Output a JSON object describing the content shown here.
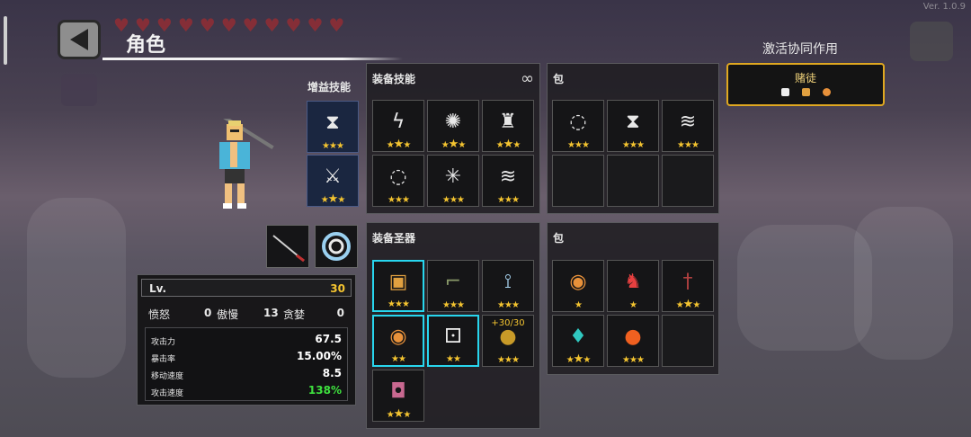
{
  "version": "Ver. 1.0.9",
  "header": {
    "title": "角色",
    "hearts": 11
  },
  "buff_skills": {
    "label": "增益技能",
    "slots": [
      {
        "icon": "hourglass-up-icon",
        "glyph": "⧗",
        "stars": 3,
        "gold": 0
      },
      {
        "icon": "sword-up-icon",
        "glyph": "⚔",
        "stars": 3,
        "gold": 1
      }
    ]
  },
  "equipped_skills": {
    "title": "装备技能",
    "slots": [
      {
        "icon": "lightning-strike-icon",
        "glyph": "ϟ",
        "stars": 3,
        "gold": 1
      },
      {
        "icon": "explosion-icon",
        "glyph": "✺",
        "stars": 3,
        "gold": 1
      },
      {
        "icon": "stone-pillar-icon",
        "glyph": "♜",
        "stars": 3,
        "gold": 1
      },
      {
        "icon": "electric-orb-icon",
        "glyph": "◌",
        "stars": 3,
        "gold": 0
      },
      {
        "icon": "burst-rays-icon",
        "glyph": "✳",
        "stars": 3,
        "gold": 0
      },
      {
        "icon": "cloud-plates-icon",
        "glyph": "≋",
        "stars": 3,
        "gold": 0
      }
    ]
  },
  "skill_bag": {
    "title": "包",
    "slots": [
      {
        "icon": "electric-orb-icon",
        "glyph": "◌",
        "stars": 3,
        "gold": 0
      },
      {
        "icon": "hourglass-up-icon",
        "glyph": "⧗",
        "stars": 3,
        "gold": 0
      },
      {
        "icon": "cloud-plates-icon",
        "glyph": "≋",
        "stars": 3,
        "gold": 0
      },
      null,
      null,
      null
    ]
  },
  "equipped_relics": {
    "title": "装备圣器",
    "slots": [
      {
        "icon": "treasure-box-icon",
        "glyph": "▣",
        "stars": 3,
        "gold": 0,
        "highlight": true,
        "color": "#e0a040"
      },
      {
        "icon": "rifle-icon",
        "glyph": "⌐",
        "stars": 3,
        "gold": 0,
        "color": "#8a9a6a"
      },
      {
        "icon": "ice-branch-icon",
        "glyph": "⟟",
        "stars": 3,
        "gold": 0,
        "color": "#a8d4f0"
      },
      {
        "icon": "orange-shield-icon",
        "glyph": "◉",
        "stars": 2,
        "gold": 0,
        "highlight": true,
        "color": "#e8913a"
      },
      {
        "icon": "dice-icon",
        "glyph": "⚀",
        "stars": 2,
        "gold": 0,
        "highlight": true,
        "color": "#eeeeee"
      },
      {
        "icon": "gold-coin-icon",
        "glyph": "●",
        "stars": 3,
        "gold": 0,
        "counter": "+30/30",
        "color": "#c89a28"
      },
      {
        "icon": "pink-bag-icon",
        "glyph": "◘",
        "stars": 3,
        "gold": 1,
        "color": "#c86890"
      }
    ]
  },
  "relic_bag": {
    "title": "包",
    "slots": [
      {
        "icon": "orange-shield-icon",
        "glyph": "◉",
        "stars": 1,
        "gold": 0,
        "color": "#e8913a"
      },
      {
        "icon": "fox-mask-icon",
        "glyph": "♞",
        "stars": 1,
        "gold": 0,
        "color": "#e84040"
      },
      {
        "icon": "dagger-icon",
        "glyph": "†",
        "stars": 3,
        "gold": 1,
        "color": "#b04040"
      },
      {
        "icon": "teal-crystal-icon",
        "glyph": "♦",
        "stars": 3,
        "gold": 1,
        "color": "#30c8c0"
      },
      {
        "icon": "fire-orb-icon",
        "glyph": "●",
        "stars": 3,
        "gold": 0,
        "color": "#f06020"
      },
      null
    ]
  },
  "synergy": {
    "title": "激活协同作用",
    "name": "赌徒",
    "icons": [
      {
        "icon": "dice-icon",
        "color": "#eeeeee"
      },
      {
        "icon": "treasure-box-icon",
        "color": "#e0a040"
      },
      {
        "icon": "orange-shield-icon",
        "color": "#e8913a"
      }
    ]
  },
  "stats": {
    "lv_label": "Lv.",
    "lv_value": "30",
    "sins": [
      {
        "label": "愤怒",
        "value": "0"
      },
      {
        "label": "傲慢",
        "value": "13"
      },
      {
        "label": "贪婪",
        "value": "0"
      }
    ],
    "attributes": [
      {
        "label": "攻击力",
        "value": "67.5",
        "color": "#ffffff"
      },
      {
        "label": "暴击率",
        "value": "15.00%",
        "color": "#ffffff"
      },
      {
        "label": "移动速度",
        "value": "8.5",
        "color": "#ffffff"
      },
      {
        "label": "攻击速度",
        "value": "138%",
        "color": "#3ee03e"
      }
    ]
  },
  "weapons": [
    {
      "icon": "katana-icon",
      "glyph": "╱"
    },
    {
      "icon": "tornado-icon",
      "glyph": "◎"
    }
  ]
}
